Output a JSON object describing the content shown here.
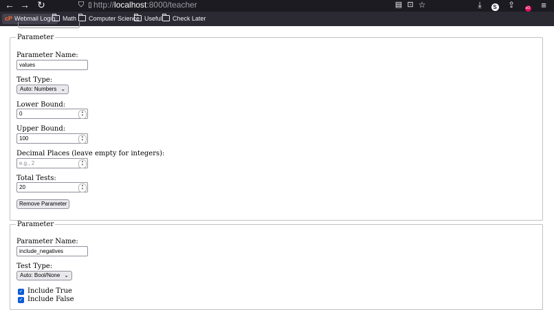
{
  "browser": {
    "url_prefix": "http://",
    "url_host": "localhost",
    "url_rest": ":8000/teacher",
    "extension_badge": "S",
    "ublock_badge": "uO"
  },
  "bookmarks": [
    {
      "label": "Webmail Login",
      "icon": "cpanel-logo",
      "logo_text": "cP"
    },
    {
      "label": "Math",
      "icon": "folder-icon"
    },
    {
      "label": "Computer Science",
      "icon": "folder-icon"
    },
    {
      "label": "Useful",
      "icon": "folder-icon"
    },
    {
      "label": "Check Later",
      "icon": "folder-icon"
    }
  ],
  "param1": {
    "legend": "Parameter",
    "name_label": "Parameter Name:",
    "name_value": "values",
    "type_label": "Test Type:",
    "type_value": "Auto: Numbers",
    "lower_label": "Lower Bound:",
    "lower_value": "0",
    "upper_label": "Upper Bound:",
    "upper_value": "100",
    "decimal_label": "Decimal Places (leave empty for integers):",
    "decimal_placeholder": "e.g., 2",
    "total_label": "Total Tests:",
    "total_value": "20",
    "remove_button": "Remove Parameter"
  },
  "param2": {
    "legend": "Parameter",
    "name_label": "Parameter Name:",
    "name_value": "include_negatives",
    "type_label": "Test Type:",
    "type_value": "Auto: Bool/None",
    "include_true_label": "Include True",
    "include_true_checked": true,
    "include_false_label": "Include False",
    "include_false_checked": true
  }
}
